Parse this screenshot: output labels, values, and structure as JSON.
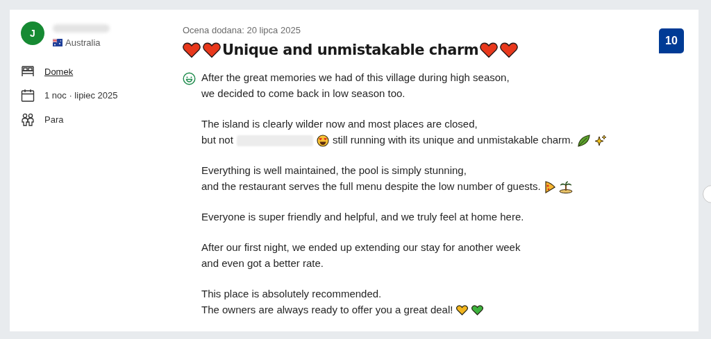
{
  "reviewer": {
    "initial": "J",
    "country": "Australia"
  },
  "stay": [
    {
      "kind": "room",
      "text": "Domek",
      "link": true
    },
    {
      "kind": "date",
      "text": "1 noc · lipiec 2025",
      "link": false
    },
    {
      "kind": "group",
      "text": "Para",
      "link": false
    }
  ],
  "review": {
    "date": "Ocena dodana: 20 lipca 2025",
    "title": "Unique and unmistakable charm",
    "score": "10",
    "paragraphs": [
      [
        [
          {
            "kind": "text",
            "text": "After the great memories we had of this village during high season,"
          }
        ],
        [
          {
            "kind": "text",
            "text": "we decided to come back in low season too."
          }
        ]
      ],
      [
        [
          {
            "kind": "text",
            "text": "The island is clearly wilder now and most places are closed,"
          }
        ],
        [
          {
            "kind": "text",
            "text": "but not"
          },
          {
            "kind": "redacted"
          },
          {
            "kind": "face"
          },
          {
            "kind": "text",
            "text": "still running with its unique and unmistakable charm."
          },
          {
            "kind": "leaf"
          },
          {
            "kind": "sparkles"
          }
        ]
      ],
      [
        [
          {
            "kind": "text",
            "text": "Everything is well maintained, the pool is simply stunning,"
          }
        ],
        [
          {
            "kind": "text",
            "text": "and the restaurant serves the full menu despite the low number of guests."
          },
          {
            "kind": "pizza"
          },
          {
            "kind": "island"
          }
        ]
      ],
      [
        [
          {
            "kind": "text",
            "text": "Everyone is super friendly and helpful, and we truly feel at home here."
          }
        ]
      ],
      [
        [
          {
            "kind": "text",
            "text": "After our first night, we ended up extending our stay for another week"
          }
        ],
        [
          {
            "kind": "text",
            "text": "and even got a better rate."
          }
        ]
      ],
      [
        [
          {
            "kind": "text",
            "text": "This place is absolutely recommended."
          }
        ],
        [
          {
            "kind": "text",
            "text": "The owners are always ready to offer you a great deal!"
          },
          {
            "kind": "heart",
            "color": "#f2b51e"
          },
          {
            "kind": "heart",
            "color": "#3db33d"
          }
        ]
      ]
    ]
  }
}
